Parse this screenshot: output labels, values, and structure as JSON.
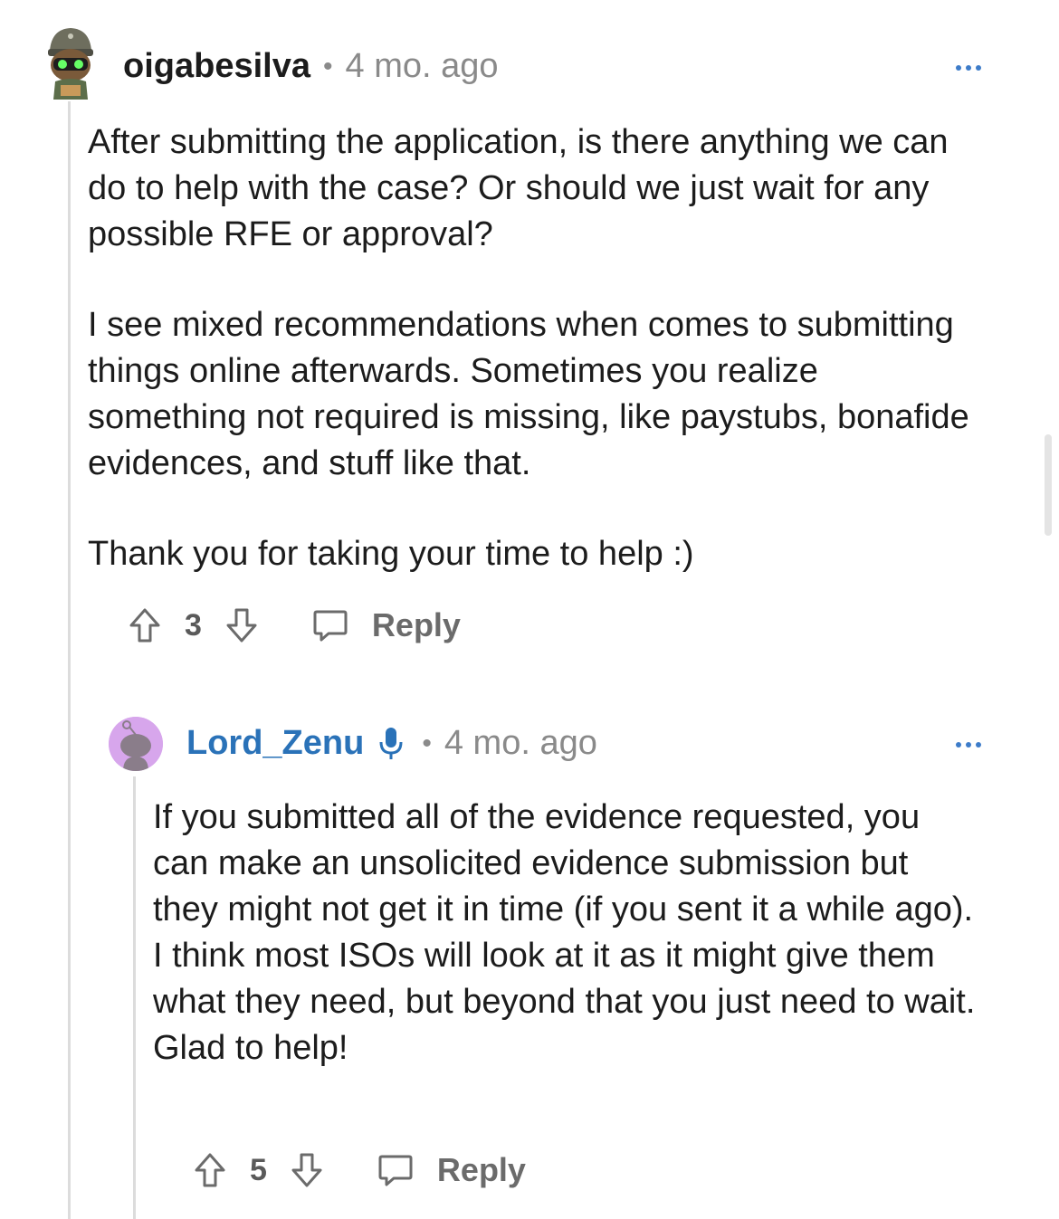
{
  "comments": [
    {
      "username": "oigabesilva",
      "separator": "•",
      "time": "4 mo. ago",
      "avatar_icon": "robot-avatar-icon",
      "paragraphs": [
        "After submitting the application, is there anything we can do to help with the case? Or should we just wait for any possible RFE or approval?",
        "I see mixed recommendations when comes to submitting things online afterwards. Sometimes you realize something not required is missing, like paystubs, bonafide evidences, and stuff like that.",
        "Thank you for taking your time to help :)"
      ],
      "score": "3",
      "reply_label": "Reply"
    },
    {
      "username": "Lord_Zenu",
      "separator": "•",
      "time": "4 mo. ago",
      "avatar_icon": "snoo-avatar-icon",
      "badge_icon": "microphone-icon",
      "paragraphs": [
        "If you submitted all of the evidence requested, you can make an unsolicited evidence submission but they might not get it in time (if you sent it a while ago). I think most ISOs will look at it as it might give them what they need, but beyond that you just need to wait. Glad to help!"
      ],
      "score": "5",
      "reply_label": "Reply"
    }
  ],
  "colors": {
    "moderator_name": "#2a72b8",
    "meta_text": "#8a8a8a",
    "thread_line": "#dcdcdc",
    "more_dots": "#3d7cc9"
  }
}
